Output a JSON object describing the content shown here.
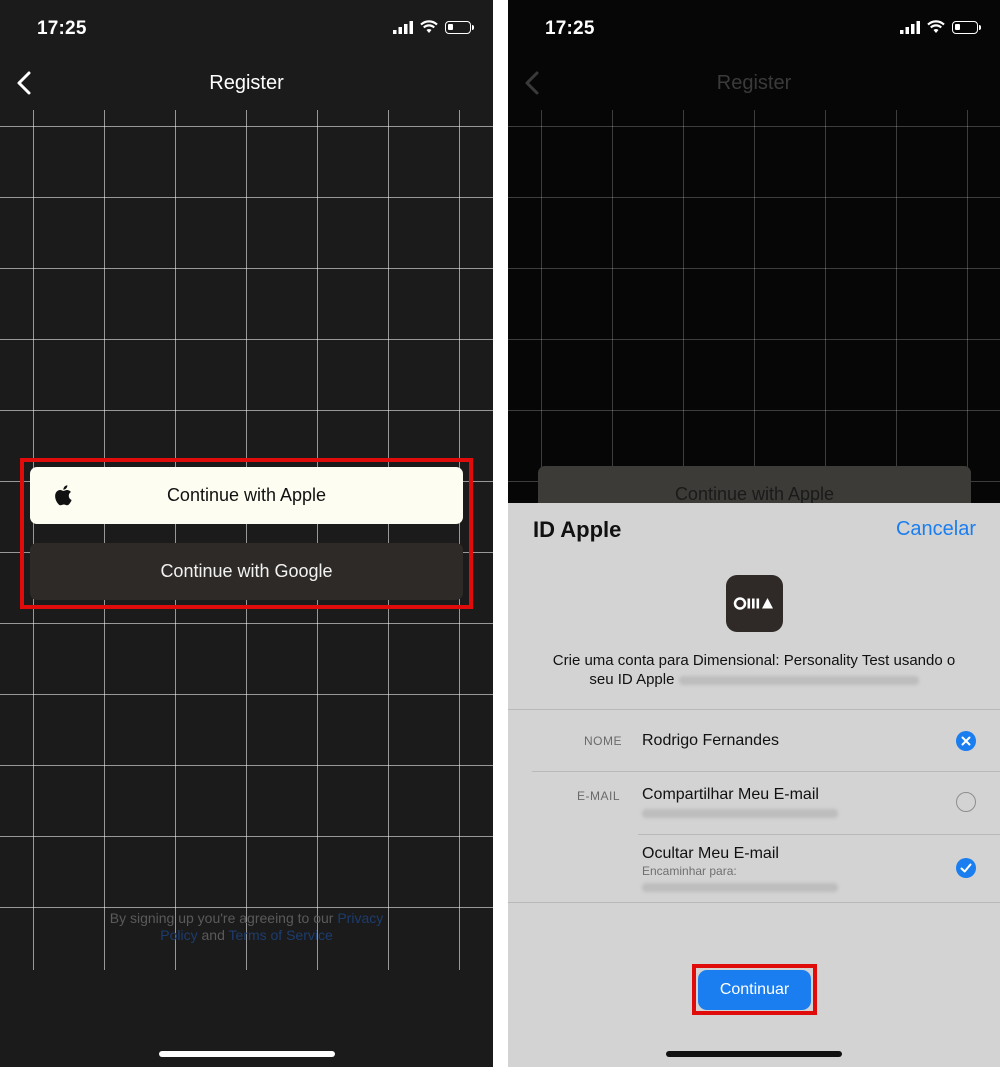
{
  "left": {
    "status": {
      "time": "17:25"
    },
    "navbar": {
      "title": "Register"
    },
    "buttons": {
      "apple": "Continue with Apple",
      "google": "Continue with Google"
    },
    "terms": {
      "prefix": "By signing up you're agreeing to our",
      "privacy": "Privacy Policy",
      "and": "and",
      "tos": "Terms of Service"
    }
  },
  "right": {
    "status": {
      "time": "17:25"
    },
    "navbar": {
      "title": "Register"
    },
    "background_button": "Continue with Apple",
    "sheet": {
      "title": "ID Apple",
      "cancel": "Cancelar",
      "description_line1": "Crie uma conta para Dimensional: Personality Test usando o",
      "description_line2": "seu ID Apple",
      "name_label": "NOME",
      "name_value": "Rodrigo Fernandes",
      "email_label": "E-MAIL",
      "share_email": "Compartilhar Meu E-mail",
      "hide_email": "Ocultar Meu E-mail",
      "forward_to": "Encaminhar para:",
      "continue": "Continuar"
    }
  },
  "colors": {
    "highlight": "#e00c0c",
    "ios_blue": "#1a7ef0",
    "apple_button_bg": "#fdfdf2",
    "google_button_bg": "#2e2a27",
    "sheet_bg": "#d3d3d3"
  },
  "icons": [
    "signal-icon",
    "wifi-icon",
    "battery-icon",
    "back-chevron-icon",
    "apple-logo-icon",
    "app-logo-icon",
    "clear-icon",
    "checkmark-icon"
  ]
}
